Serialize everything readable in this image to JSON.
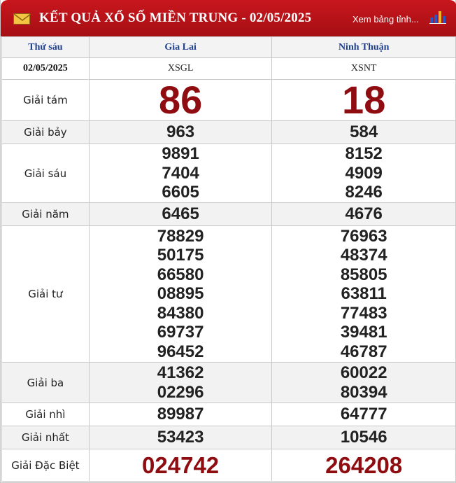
{
  "header": {
    "title": "KẾT QUẢ XỔ SỐ MIỀN TRUNG - 02/05/2025",
    "more_link": "Xem bảng tỉnh...",
    "icon_mail": "mail-icon",
    "icon_chart": "bar-chart-icon"
  },
  "table": {
    "day": "Thứ sáu",
    "date": "02/05/2025",
    "provinces": [
      {
        "name": "Gia Lai",
        "code": "XSGL"
      },
      {
        "name": "Ninh Thuận",
        "code": "XSNT"
      }
    ],
    "prizes": [
      {
        "label": "Giải tám",
        "gl": [
          "86"
        ],
        "nt": [
          "18"
        ]
      },
      {
        "label": "Giải bảy",
        "gl": [
          "963"
        ],
        "nt": [
          "584"
        ]
      },
      {
        "label": "Giải sáu",
        "gl": [
          "9891",
          "7404",
          "6605"
        ],
        "nt": [
          "8152",
          "4909",
          "8246"
        ]
      },
      {
        "label": "Giải năm",
        "gl": [
          "6465"
        ],
        "nt": [
          "4676"
        ]
      },
      {
        "label": "Giải tư",
        "gl": [
          "78829",
          "50175",
          "66580",
          "08895",
          "84380",
          "69737",
          "96452"
        ],
        "nt": [
          "76963",
          "48374",
          "85805",
          "63811",
          "77483",
          "39481",
          "46787"
        ]
      },
      {
        "label": "Giải ba",
        "gl": [
          "41362",
          "02296"
        ],
        "nt": [
          "60022",
          "80394"
        ]
      },
      {
        "label": "Giải nhì",
        "gl": [
          "89987"
        ],
        "nt": [
          "64777"
        ]
      },
      {
        "label": "Giải nhất",
        "gl": [
          "53423"
        ],
        "nt": [
          "10546"
        ]
      },
      {
        "label": "Giải Đặc Biệt",
        "gl": [
          "024742"
        ],
        "nt": [
          "264208"
        ]
      }
    ]
  },
  "colors": {
    "header_bg": "#b3121a",
    "accent_red": "#8f0c10",
    "header_text_blue": "#1f3f8f"
  }
}
